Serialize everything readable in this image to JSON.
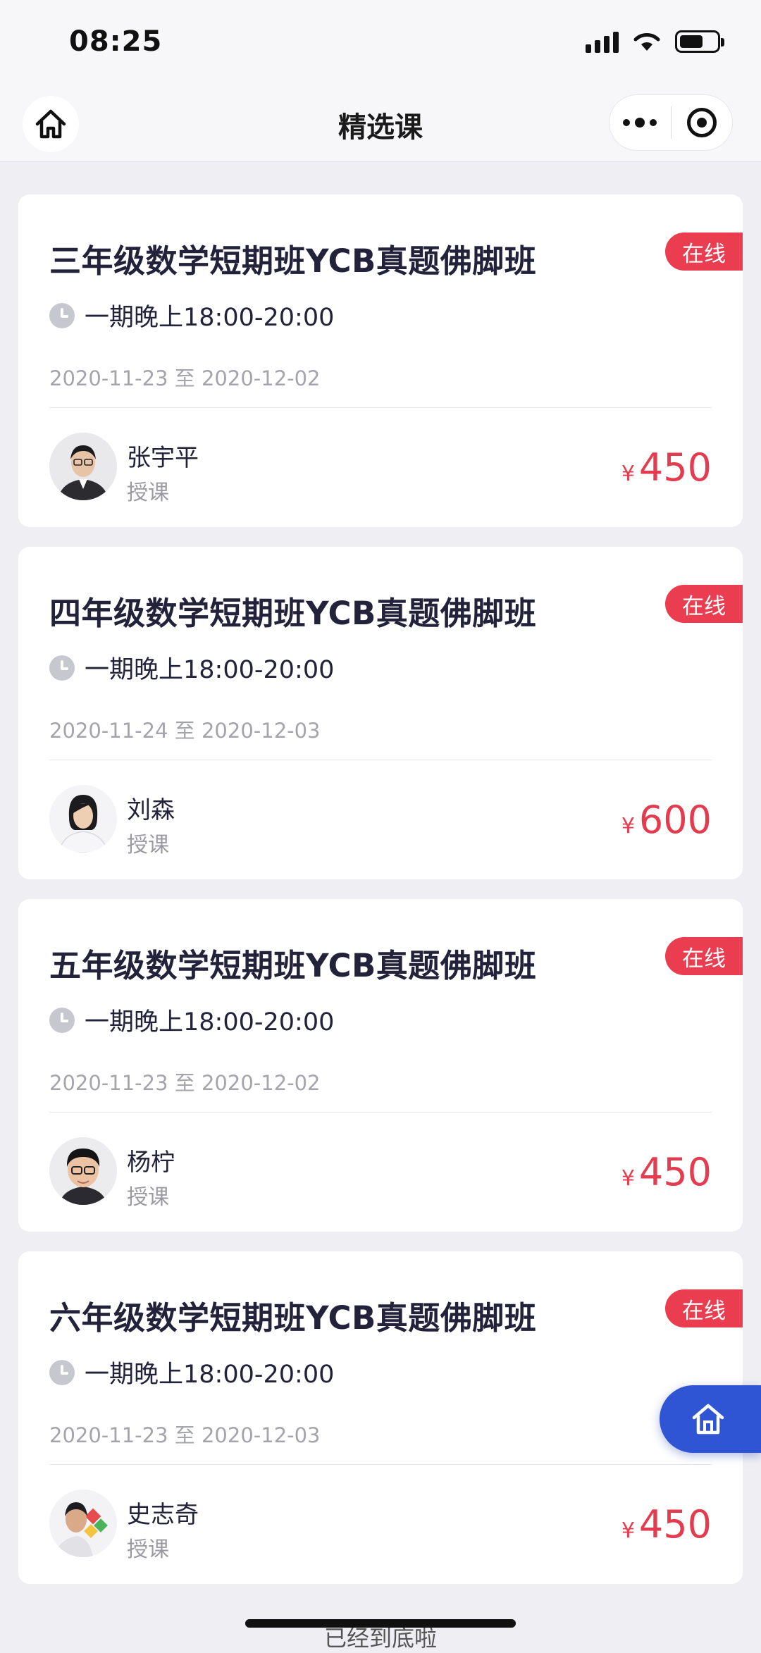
{
  "status": {
    "time": "08:25"
  },
  "nav": {
    "title": "精选课"
  },
  "courses": [
    {
      "title": "三年级数学短期班YCB真题佛脚班",
      "badge": "在线",
      "schedule": "一期晚上18:00-20:00",
      "dates": "2020-11-23 至 2020-12-02",
      "teacher": "张宇平",
      "role": "授课",
      "currency": "¥",
      "price": "450"
    },
    {
      "title": "四年级数学短期班YCB真题佛脚班",
      "badge": "在线",
      "schedule": "一期晚上18:00-20:00",
      "dates": "2020-11-24 至 2020-12-03",
      "teacher": "刘森",
      "role": "授课",
      "currency": "¥",
      "price": "600"
    },
    {
      "title": "五年级数学短期班YCB真题佛脚班",
      "badge": "在线",
      "schedule": "一期晚上18:00-20:00",
      "dates": "2020-11-23 至 2020-12-02",
      "teacher": "杨柠",
      "role": "授课",
      "currency": "¥",
      "price": "450"
    },
    {
      "title": "六年级数学短期班YCB真题佛脚班",
      "badge": "在线",
      "schedule": "一期晚上18:00-20:00",
      "dates": "2020-11-23 至 2020-12-03",
      "teacher": "史志奇",
      "role": "授课",
      "currency": "¥",
      "price": "450"
    }
  ],
  "footer": {
    "text": "已经到底啦"
  },
  "colors": {
    "accent": "#ea3d4f",
    "float_button": "#2f55d4",
    "background": "#efeff3"
  }
}
